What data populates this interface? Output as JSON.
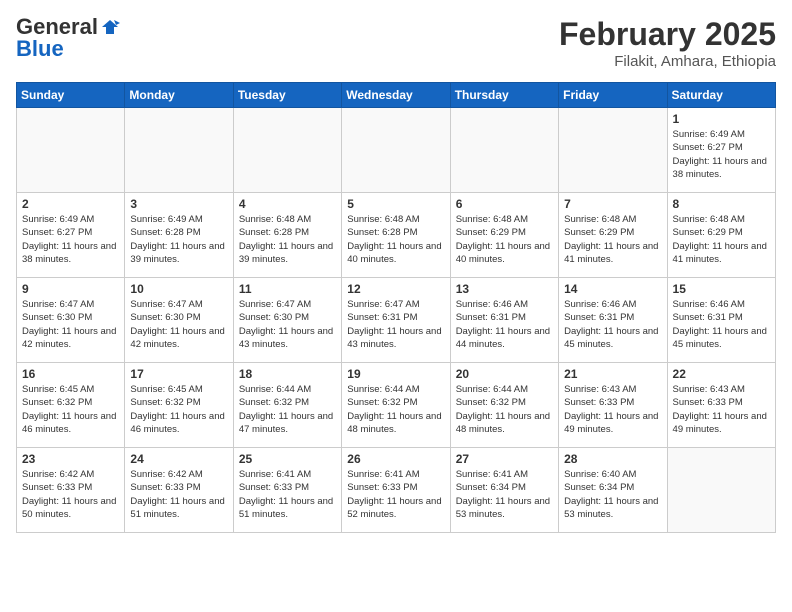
{
  "header": {
    "logo_general": "General",
    "logo_blue": "Blue",
    "title": "February 2025",
    "subtitle": "Filakit, Amhara, Ethiopia"
  },
  "weekdays": [
    "Sunday",
    "Monday",
    "Tuesday",
    "Wednesday",
    "Thursday",
    "Friday",
    "Saturday"
  ],
  "weeks": [
    [
      {
        "day": "",
        "empty": true
      },
      {
        "day": "",
        "empty": true
      },
      {
        "day": "",
        "empty": true
      },
      {
        "day": "",
        "empty": true
      },
      {
        "day": "",
        "empty": true
      },
      {
        "day": "",
        "empty": true
      },
      {
        "day": "1",
        "sunrise": "6:49 AM",
        "sunset": "6:27 PM",
        "daylight": "11 hours and 38 minutes."
      }
    ],
    [
      {
        "day": "2",
        "sunrise": "6:49 AM",
        "sunset": "6:27 PM",
        "daylight": "11 hours and 38 minutes."
      },
      {
        "day": "3",
        "sunrise": "6:49 AM",
        "sunset": "6:28 PM",
        "daylight": "11 hours and 39 minutes."
      },
      {
        "day": "4",
        "sunrise": "6:48 AM",
        "sunset": "6:28 PM",
        "daylight": "11 hours and 39 minutes."
      },
      {
        "day": "5",
        "sunrise": "6:48 AM",
        "sunset": "6:28 PM",
        "daylight": "11 hours and 40 minutes."
      },
      {
        "day": "6",
        "sunrise": "6:48 AM",
        "sunset": "6:29 PM",
        "daylight": "11 hours and 40 minutes."
      },
      {
        "day": "7",
        "sunrise": "6:48 AM",
        "sunset": "6:29 PM",
        "daylight": "11 hours and 41 minutes."
      },
      {
        "day": "8",
        "sunrise": "6:48 AM",
        "sunset": "6:29 PM",
        "daylight": "11 hours and 41 minutes."
      }
    ],
    [
      {
        "day": "9",
        "sunrise": "6:47 AM",
        "sunset": "6:30 PM",
        "daylight": "11 hours and 42 minutes."
      },
      {
        "day": "10",
        "sunrise": "6:47 AM",
        "sunset": "6:30 PM",
        "daylight": "11 hours and 42 minutes."
      },
      {
        "day": "11",
        "sunrise": "6:47 AM",
        "sunset": "6:30 PM",
        "daylight": "11 hours and 43 minutes."
      },
      {
        "day": "12",
        "sunrise": "6:47 AM",
        "sunset": "6:31 PM",
        "daylight": "11 hours and 43 minutes."
      },
      {
        "day": "13",
        "sunrise": "6:46 AM",
        "sunset": "6:31 PM",
        "daylight": "11 hours and 44 minutes."
      },
      {
        "day": "14",
        "sunrise": "6:46 AM",
        "sunset": "6:31 PM",
        "daylight": "11 hours and 45 minutes."
      },
      {
        "day": "15",
        "sunrise": "6:46 AM",
        "sunset": "6:31 PM",
        "daylight": "11 hours and 45 minutes."
      }
    ],
    [
      {
        "day": "16",
        "sunrise": "6:45 AM",
        "sunset": "6:32 PM",
        "daylight": "11 hours and 46 minutes."
      },
      {
        "day": "17",
        "sunrise": "6:45 AM",
        "sunset": "6:32 PM",
        "daylight": "11 hours and 46 minutes."
      },
      {
        "day": "18",
        "sunrise": "6:44 AM",
        "sunset": "6:32 PM",
        "daylight": "11 hours and 47 minutes."
      },
      {
        "day": "19",
        "sunrise": "6:44 AM",
        "sunset": "6:32 PM",
        "daylight": "11 hours and 48 minutes."
      },
      {
        "day": "20",
        "sunrise": "6:44 AM",
        "sunset": "6:32 PM",
        "daylight": "11 hours and 48 minutes."
      },
      {
        "day": "21",
        "sunrise": "6:43 AM",
        "sunset": "6:33 PM",
        "daylight": "11 hours and 49 minutes."
      },
      {
        "day": "22",
        "sunrise": "6:43 AM",
        "sunset": "6:33 PM",
        "daylight": "11 hours and 49 minutes."
      }
    ],
    [
      {
        "day": "23",
        "sunrise": "6:42 AM",
        "sunset": "6:33 PM",
        "daylight": "11 hours and 50 minutes."
      },
      {
        "day": "24",
        "sunrise": "6:42 AM",
        "sunset": "6:33 PM",
        "daylight": "11 hours and 51 minutes."
      },
      {
        "day": "25",
        "sunrise": "6:41 AM",
        "sunset": "6:33 PM",
        "daylight": "11 hours and 51 minutes."
      },
      {
        "day": "26",
        "sunrise": "6:41 AM",
        "sunset": "6:33 PM",
        "daylight": "11 hours and 52 minutes."
      },
      {
        "day": "27",
        "sunrise": "6:41 AM",
        "sunset": "6:34 PM",
        "daylight": "11 hours and 53 minutes."
      },
      {
        "day": "28",
        "sunrise": "6:40 AM",
        "sunset": "6:34 PM",
        "daylight": "11 hours and 53 minutes."
      },
      {
        "day": "",
        "empty": true
      }
    ]
  ]
}
